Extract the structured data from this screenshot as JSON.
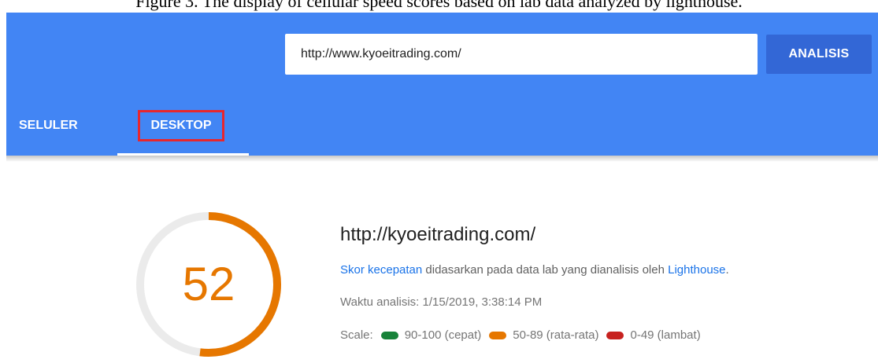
{
  "caption": "Figure 3. The display of cellular speed scores based on lab data analyzed by lighthouse.",
  "search": {
    "url_value": "http://www.kyoeitrading.com/",
    "analyze_label": "ANALISIS"
  },
  "tabs": [
    {
      "label": "SELULER",
      "selected": false
    },
    {
      "label": "DESKTOP",
      "selected": true
    }
  ],
  "result": {
    "score": "52",
    "score_value": 52,
    "score_color": "#e67700",
    "site_title": "http://kyoeitrading.com/",
    "desc_link1": "Skor kecepatan",
    "desc_mid": " didasarkan pada data lab yang dianalisis oleh ",
    "desc_link2": "Lighthouse",
    "desc_end": ".",
    "analysis_time": "Waktu analisis: 1/15/2019, 3:38:14 PM",
    "scale_label": "Scale:",
    "scale": [
      {
        "label": "90-100 (cepat)",
        "color": "#178239"
      },
      {
        "label": "50-89 (rata-rata)",
        "color": "#e67700"
      },
      {
        "label": "0-49 (lambat)",
        "color": "#c7221f"
      }
    ]
  },
  "colors": {
    "header_bg": "#4285f4",
    "button_bg": "#3367d6",
    "highlight_box": "#e8262d",
    "link": "#1a73e8"
  }
}
